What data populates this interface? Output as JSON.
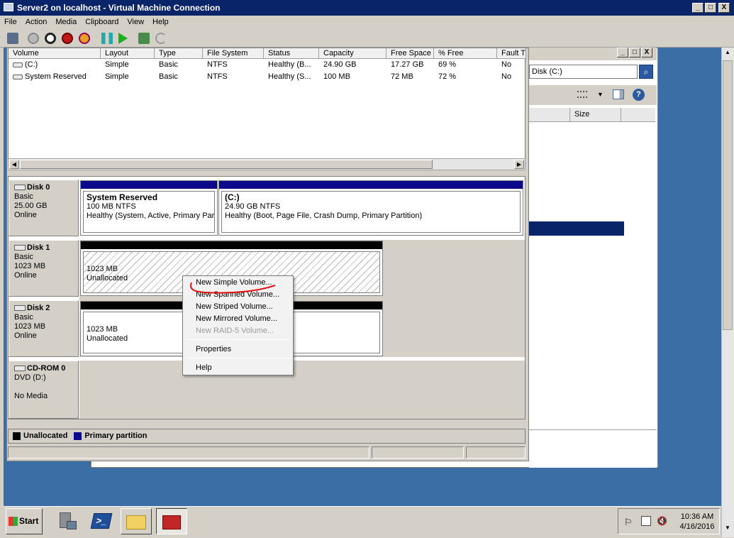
{
  "window": {
    "title": "Server2 on localhost - Virtual Machine Connection",
    "menu": [
      "File",
      "Action",
      "Media",
      "Clipboard",
      "View",
      "Help"
    ]
  },
  "caption_buttons": [
    "_",
    "□",
    "X"
  ],
  "volume_list": {
    "columns": [
      "Volume",
      "Layout",
      "Type",
      "File System",
      "Status",
      "Capacity",
      "Free Space",
      "% Free",
      "Fault T"
    ],
    "rows": [
      [
        "(C:)",
        "Simple",
        "Basic",
        "NTFS",
        "Healthy (B...",
        "24.90 GB",
        "17.27 GB",
        "69 %",
        "No"
      ],
      [
        "System Reserved",
        "Simple",
        "Basic",
        "NTFS",
        "Healthy (S...",
        "100 MB",
        "72 MB",
        "72 %",
        "No"
      ]
    ]
  },
  "disks": [
    {
      "name": "Disk 0",
      "type": "Basic",
      "size": "25.00 GB",
      "status": "Online"
    },
    {
      "name": "Disk 1",
      "type": "Basic",
      "size": "1023 MB",
      "status": "Online"
    },
    {
      "name": "Disk 2",
      "type": "Basic",
      "size": "1023 MB",
      "status": "Online"
    },
    {
      "name": "CD-ROM 0",
      "type": "DVD (D:)",
      "size": "",
      "status": "No Media"
    }
  ],
  "partitions": {
    "sysres": {
      "title": "System Reserved",
      "fs": "100 MB NTFS",
      "status": "Healthy (System, Active, Primary Part"
    },
    "c": {
      "title": "(C:)",
      "fs": "24.90 GB NTFS",
      "status": "Healthy (Boot, Page File, Crash Dump, Primary Partition)"
    },
    "disk1": {
      "size": "1023 MB",
      "state": "Unallocated"
    },
    "disk2": {
      "size": "1023 MB",
      "state": "Unallocated"
    }
  },
  "legend": {
    "unallocated": "Unallocated",
    "primary": "Primary partition"
  },
  "context_menu": {
    "new_simple": "New Simple Volume...",
    "new_spanned": "New Spanned Volume...",
    "new_striped": "New Striped Volume...",
    "new_mirrored": "New Mirrored Volume...",
    "new_raid5": "New RAID-5 Volume...",
    "properties": "Properties",
    "help": "Help"
  },
  "side_panel": {
    "search_value": "Disk (C:)",
    "column_size": "Size"
  },
  "taskbar": {
    "start": "Start",
    "time": "10:36 AM",
    "date": "4/16/2016"
  },
  "colors": {
    "title_bar": "#0a246a",
    "primary_partition": "#0a0a8a",
    "desktop": "#3a6ea5",
    "annotation": "#e01010"
  }
}
